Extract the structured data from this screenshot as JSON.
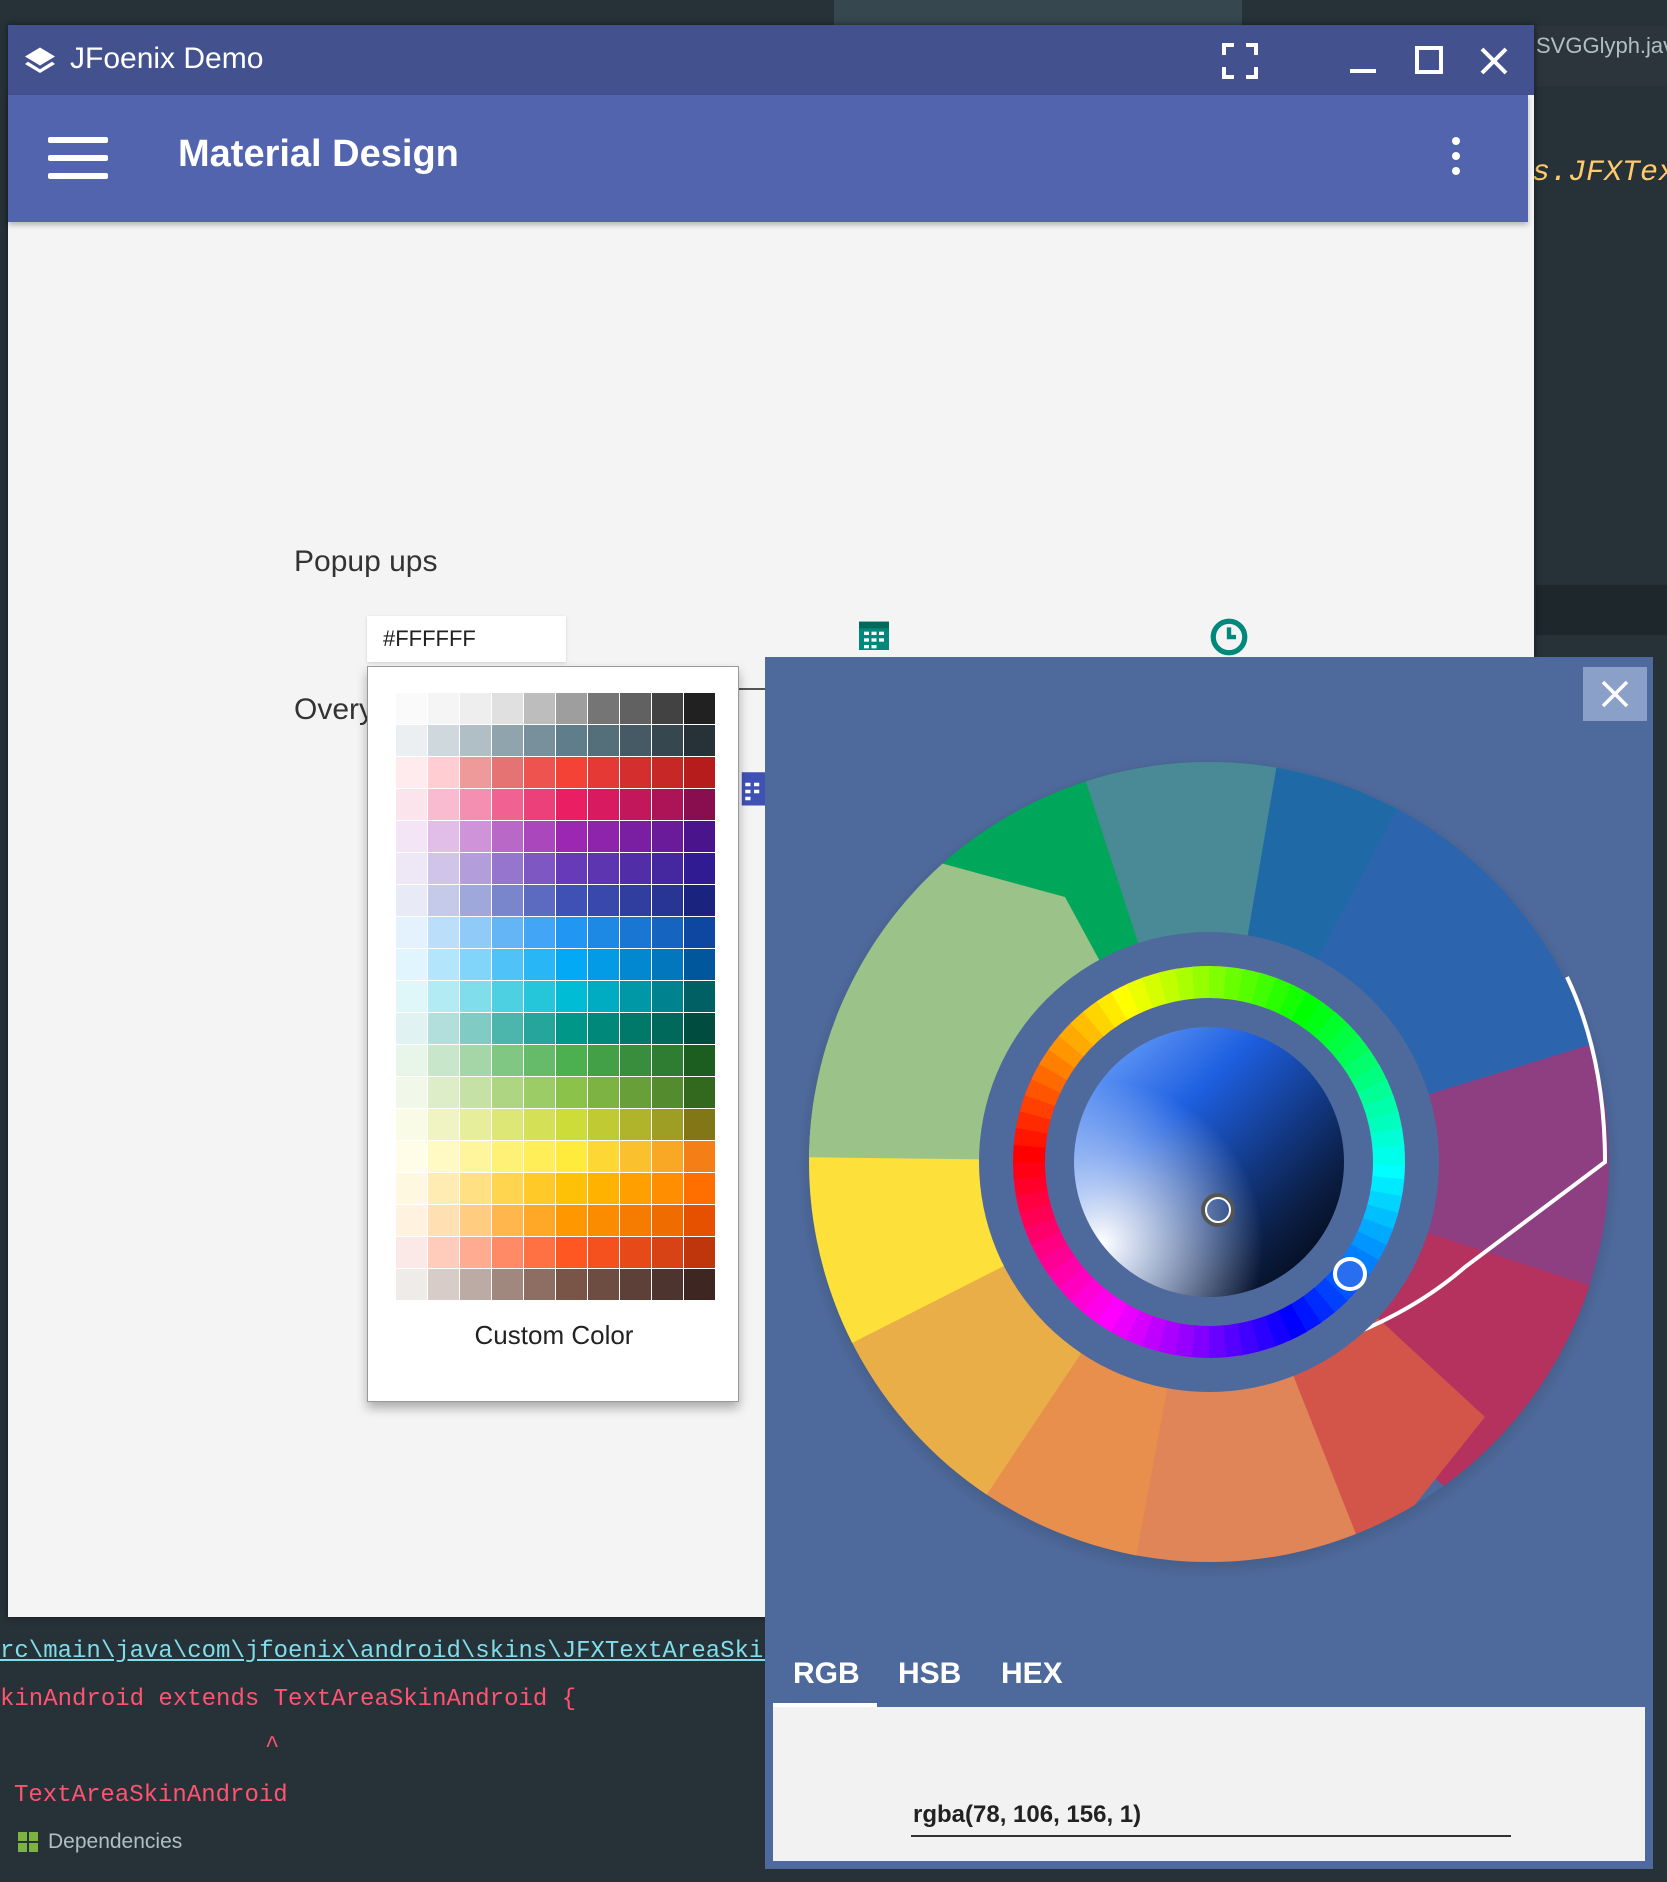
{
  "ide": {
    "tab_label": "SVGGlyph.jav",
    "code_right": "s.JFXTex",
    "path_line": "rc\\main\\java\\com\\jfoenix\\android\\skins\\JFXTextAreaSkinA",
    "line2": "kinAndroid extends TextAreaSkinAndroid {",
    "line3": "^",
    "line4": "TextAreaSkinAndroid",
    "dependencies_label": "Dependencies"
  },
  "window": {
    "title": "JFoenix Demo",
    "icons": [
      "layers-icon",
      "fullscreen-icon",
      "minimize-icon",
      "maximize-icon",
      "close-icon"
    ]
  },
  "toolbar": {
    "title": "Material Design",
    "menu_icon": "hamburger-icon",
    "options_icon": "more-vert-icon"
  },
  "content": {
    "popup_label": "Popup ups",
    "overlay_label": "Overy",
    "date_icon": "calendar-icon",
    "time_icon": "clock-icon"
  },
  "palette": {
    "hex_value": "#FFFFFF",
    "custom_color_label": "Custom Color",
    "colors": [
      [
        "#fafafa",
        "#f5f5f5",
        "#eeeeee",
        "#e0e0e0",
        "#bdbdbd",
        "#9e9e9e",
        "#757575",
        "#616161",
        "#424242",
        "#212121"
      ],
      [
        "#eceff1",
        "#cfd8dc",
        "#b0bec5",
        "#90a4ae",
        "#78909c",
        "#607d8b",
        "#546e7a",
        "#455a64",
        "#37474f",
        "#263238"
      ],
      [
        "#ffebee",
        "#ffcdd2",
        "#ef9a9a",
        "#e57373",
        "#ef5350",
        "#f44336",
        "#e53935",
        "#d32f2f",
        "#c62828",
        "#b71c1c"
      ],
      [
        "#fce4ec",
        "#f8bbd0",
        "#f48fb1",
        "#f06292",
        "#ec407a",
        "#e91e63",
        "#d81b60",
        "#c2185b",
        "#ad1457",
        "#880e4f"
      ],
      [
        "#f3e5f5",
        "#e1bee7",
        "#ce93d8",
        "#ba68c8",
        "#ab47bc",
        "#9c27b0",
        "#8e24aa",
        "#7b1fa2",
        "#6a1b9a",
        "#4a148c"
      ],
      [
        "#ede7f6",
        "#d1c4e9",
        "#b39ddb",
        "#9575cd",
        "#7e57c2",
        "#673ab7",
        "#5e35b1",
        "#512da8",
        "#4527a0",
        "#311b92"
      ],
      [
        "#e8eaf6",
        "#c5cae9",
        "#9fa8da",
        "#7986cb",
        "#5c6bc0",
        "#3f51b5",
        "#3949ab",
        "#303f9f",
        "#283593",
        "#1a237e"
      ],
      [
        "#e3f2fd",
        "#bbdefb",
        "#90caf9",
        "#64b5f6",
        "#42a5f5",
        "#2196f3",
        "#1e88e5",
        "#1976d2",
        "#1565c0",
        "#0d47a1"
      ],
      [
        "#e1f5fe",
        "#b3e5fc",
        "#81d4fa",
        "#4fc3f7",
        "#29b6f6",
        "#03a9f4",
        "#039be5",
        "#0288d1",
        "#0277bd",
        "#01579b"
      ],
      [
        "#e0f7fa",
        "#b2ebf2",
        "#80deea",
        "#4dd0e1",
        "#26c6da",
        "#00bcd4",
        "#00acc1",
        "#0097a7",
        "#00838f",
        "#006064"
      ],
      [
        "#e0f2f1",
        "#b2dfdb",
        "#80cbc4",
        "#4db6ac",
        "#26a69a",
        "#009688",
        "#00897b",
        "#00796b",
        "#00695c",
        "#004d40"
      ],
      [
        "#e8f5e9",
        "#c8e6c9",
        "#a5d6a7",
        "#81c784",
        "#66bb6a",
        "#4caf50",
        "#43a047",
        "#388e3c",
        "#2e7d32",
        "#1b5e20"
      ],
      [
        "#f1f8e9",
        "#dcedc8",
        "#c5e1a5",
        "#aed581",
        "#9ccc65",
        "#8bc34a",
        "#7cb342",
        "#689f38",
        "#558b2f",
        "#33691e"
      ],
      [
        "#f9fbe7",
        "#f0f4c3",
        "#e6ee9c",
        "#dce775",
        "#d4e157",
        "#cddc39",
        "#c0ca33",
        "#afb42b",
        "#9e9d24",
        "#827717"
      ],
      [
        "#fffde7",
        "#fff9c4",
        "#fff59d",
        "#fff176",
        "#ffee58",
        "#ffeb3b",
        "#fdd835",
        "#fbc02d",
        "#f9a825",
        "#f57f17"
      ],
      [
        "#fff8e1",
        "#ffecb3",
        "#ffe082",
        "#ffd54f",
        "#ffca28",
        "#ffc107",
        "#ffb300",
        "#ffa000",
        "#ff8f00",
        "#ff6f00"
      ],
      [
        "#fff3e0",
        "#ffe0b2",
        "#ffcc80",
        "#ffb74d",
        "#ffa726",
        "#ff9800",
        "#fb8c00",
        "#f57c00",
        "#ef6c00",
        "#e65100"
      ],
      [
        "#fbe9e7",
        "#ffccbc",
        "#ffab91",
        "#ff8a65",
        "#ff7043",
        "#ff5722",
        "#f4511e",
        "#e64a19",
        "#d84315",
        "#bf360c"
      ],
      [
        "#efebe9",
        "#d7ccc8",
        "#bcaaa4",
        "#a1887f",
        "#8d6e63",
        "#795548",
        "#6d4c41",
        "#5d4037",
        "#4e342e",
        "#3e2723"
      ]
    ]
  },
  "picker": {
    "close_icon": "close-icon",
    "tabs": [
      "RGB",
      "HSB",
      "HEX"
    ],
    "active_tab": "RGB",
    "value": "rgba(78, 106, 156, 1)",
    "selected_color": "#4e6a9c"
  }
}
